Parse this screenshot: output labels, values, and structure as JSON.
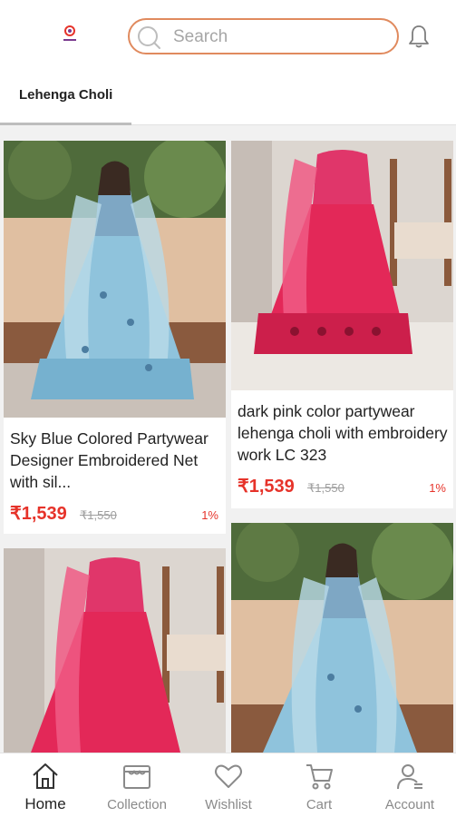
{
  "header": {
    "search_placeholder": "Search"
  },
  "tabs": [
    {
      "label": "Lehenga Choli"
    }
  ],
  "products": [
    {
      "title": "Sky Blue Colored Partywear Designer Embroidered Net with sil...",
      "price": "₹1,539",
      "mrp": "₹1,550",
      "discount": "1%"
    },
    {
      "title": "dark pink color partywear lehenga choli with embroidery work LC 323",
      "price": "₹1,539",
      "mrp": "₹1,550",
      "discount": "1%"
    }
  ],
  "nav": [
    {
      "label": "Home",
      "icon": "home-icon"
    },
    {
      "label": "Collection",
      "icon": "collection-icon"
    },
    {
      "label": "Wishlist",
      "icon": "heart-icon"
    },
    {
      "label": "Cart",
      "icon": "cart-icon"
    },
    {
      "label": "Account",
      "icon": "account-icon"
    }
  ],
  "colors": {
    "accent": "#e6332a",
    "search_border": "#e08a5e"
  }
}
